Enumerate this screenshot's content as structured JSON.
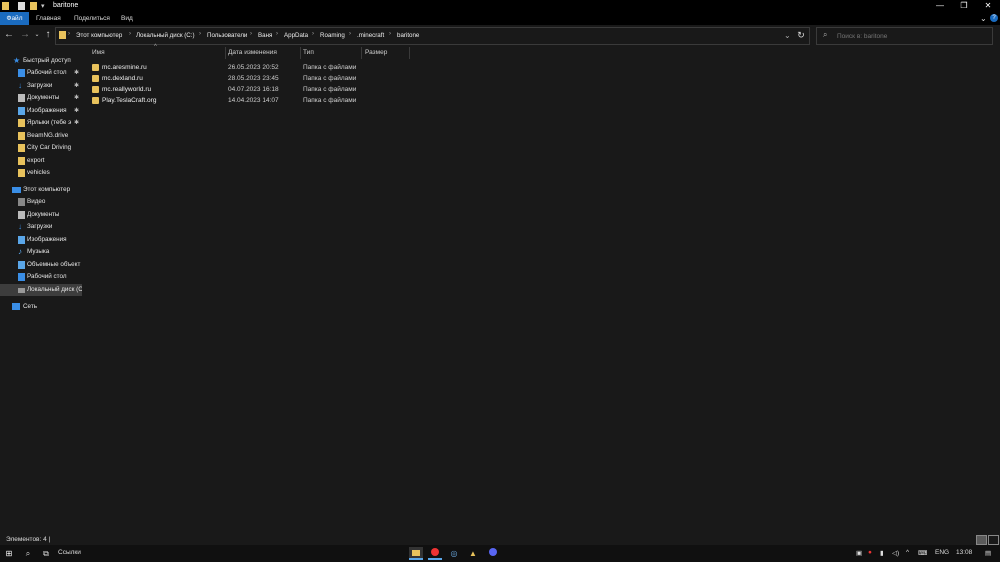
{
  "window": {
    "title": "baritone",
    "controls": {
      "minimize": "—",
      "maximize": "❐",
      "close": "✕"
    }
  },
  "ribbon": {
    "tabs": [
      "Файл",
      "Главная",
      "Поделиться",
      "Вид"
    ],
    "collapse_icon": "chevron-down-icon",
    "help_icon": "help-icon"
  },
  "address": {
    "crumbs": [
      "Этот компьютер",
      "Локальный диск (C:)",
      "Пользователи",
      "Ваня",
      "AppData",
      "Roaming",
      ".minecraft",
      "baritone"
    ],
    "search_placeholder": "Поиск в: baritone"
  },
  "nav_pane": {
    "quick_access_label": "Быстрый доступ",
    "quick_items": [
      {
        "label": "Рабочий стол",
        "pinned": true
      },
      {
        "label": "Загрузки",
        "pinned": true
      },
      {
        "label": "Документы",
        "pinned": true
      },
      {
        "label": "Изображения",
        "pinned": true
      },
      {
        "label": "Ярлыки (тебе э",
        "pinned": true
      },
      {
        "label": "BeamNG.drive",
        "pinned": false
      },
      {
        "label": "City Car Driving",
        "pinned": false
      },
      {
        "label": "export",
        "pinned": false
      },
      {
        "label": "vehicles",
        "pinned": false
      }
    ],
    "this_pc_label": "Этот компьютер",
    "pc_items": [
      "Видео",
      "Документы",
      "Загрузки",
      "Изображения",
      "Музыка",
      "Объемные объект",
      "Рабочий стол",
      "Локальный диск (C"
    ],
    "network_label": "Сеть",
    "pin_glyph": "📌"
  },
  "columns": [
    "Имя",
    "Дата изменения",
    "Тип",
    "Размер"
  ],
  "files": [
    {
      "name": "mc.aresmine.ru",
      "date": "26.05.2023 20:52",
      "type": "Папка с файлами"
    },
    {
      "name": "mc.dexland.ru",
      "date": "28.05.2023 23:45",
      "type": "Папка с файлами"
    },
    {
      "name": "mc.reallyworld.ru",
      "date": "04.07.2023 16:18",
      "type": "Папка с файлами"
    },
    {
      "name": "Play.TeslaCraft.org",
      "date": "14.04.2023 14:07",
      "type": "Папка с файлами"
    }
  ],
  "status": {
    "text": "Элементов: 4  |"
  },
  "taskbar": {
    "search_label": "Ссылки",
    "tray": {
      "lang": "ENG",
      "time": "13:08"
    }
  },
  "colors": {
    "accent": "#1a6bbf",
    "folder": "#e8c25c",
    "background": "#191919"
  }
}
